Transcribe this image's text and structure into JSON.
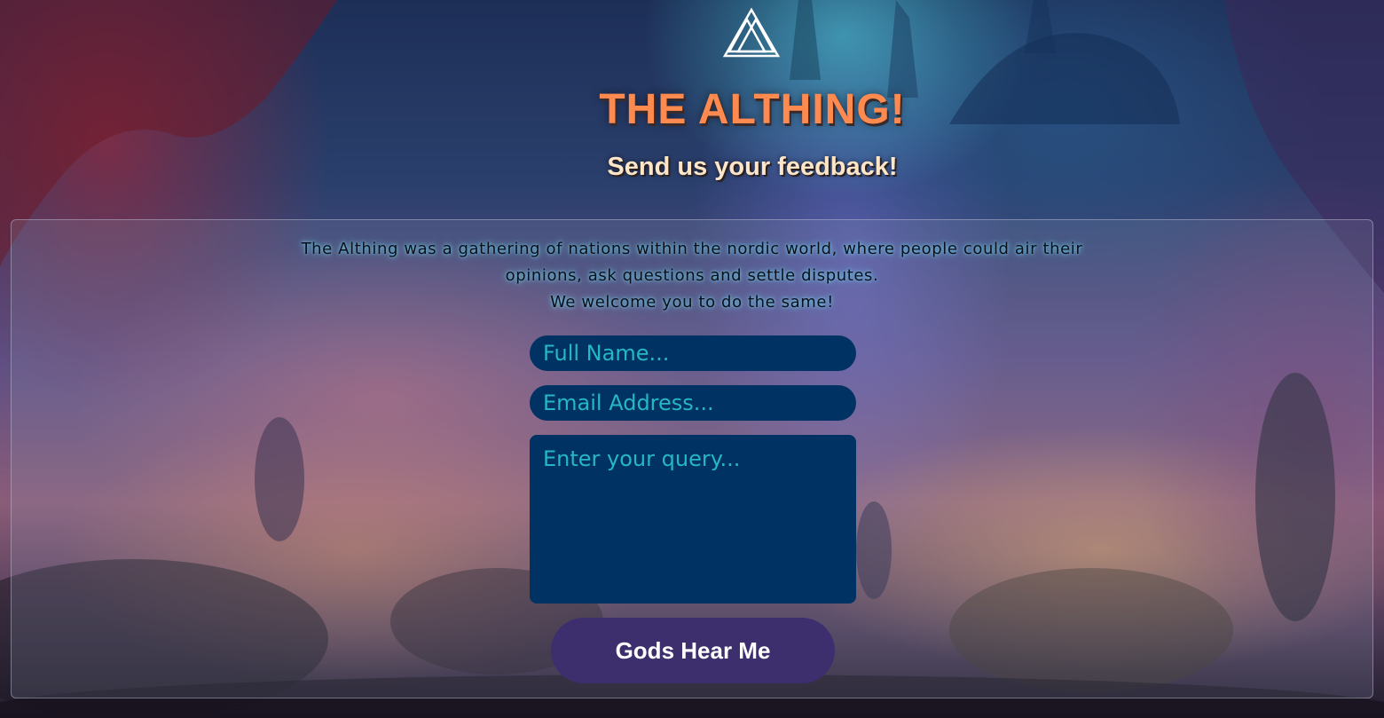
{
  "header": {
    "logo_icon": "valknut-triangle-icon",
    "title": "THE ALTHING!",
    "subtitle": "Send us your feedback!"
  },
  "intro": {
    "line1": "The Althing was a gathering of nations within the nordic world, where people could air their",
    "line2": "opinions, ask questions and settle disputes.",
    "line3": "We welcome you to do the same!"
  },
  "form": {
    "name_placeholder": "Full Name...",
    "email_placeholder": "Email Address...",
    "query_placeholder": "Enter your query...",
    "submit_label": "Gods Hear Me"
  },
  "colors": {
    "title": "#ff8a50",
    "subtitle": "#fde6c8",
    "field_bg": "#003363",
    "field_text": "#26b7c4",
    "button_bg": "#3d2f6e"
  }
}
